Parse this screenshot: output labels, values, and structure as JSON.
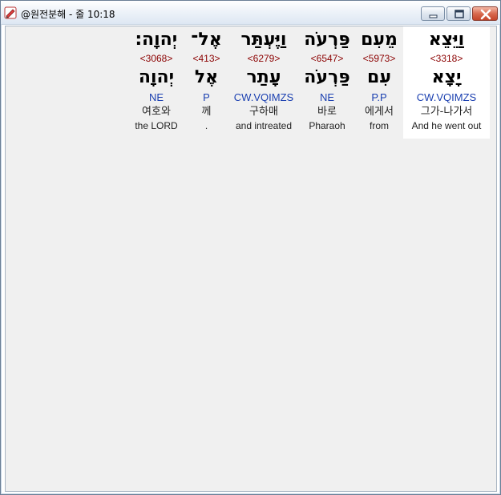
{
  "window": {
    "title": "@원전분해 - 줄 10:18"
  },
  "colors": {
    "strong_number": "#8b0000",
    "morphology": "#1a3fb0",
    "highlight": "#ffffff"
  },
  "words": [
    {
      "hebrew": "וַיֵּצֵא",
      "strong": "<3318>",
      "root": "יָצָא",
      "morph": "CW.VQIMZS",
      "korean": "그가-나가서",
      "english": "And he went out",
      "highlighted": true
    },
    {
      "hebrew": "מֵעִם",
      "strong": "<5973>",
      "root": "עִם",
      "morph": "P.P",
      "korean": "에게서",
      "english": "from",
      "highlighted": false
    },
    {
      "hebrew": "פַּרְעֹה",
      "strong": "<6547>",
      "root": "פַּרְעֹה",
      "morph": "NE",
      "korean": "바로",
      "english": "Pharaoh",
      "highlighted": false
    },
    {
      "hebrew": "וַיֶּעְתַּר",
      "strong": "<6279>",
      "root": "עָתַר",
      "morph": "CW.VQIMZS",
      "korean": "구하매",
      "english": "and intreated",
      "highlighted": false
    },
    {
      "hebrew": "אֶל־",
      "strong": "<413>",
      "root": "אֶל",
      "morph": "P",
      "korean": "께",
      "english": ".",
      "highlighted": false
    },
    {
      "hebrew": "יְהוָה׃",
      "strong": "<3068>",
      "root": "יְהוָה",
      "morph": "NE",
      "korean": "여호와",
      "english": "the LORD",
      "highlighted": false
    }
  ]
}
